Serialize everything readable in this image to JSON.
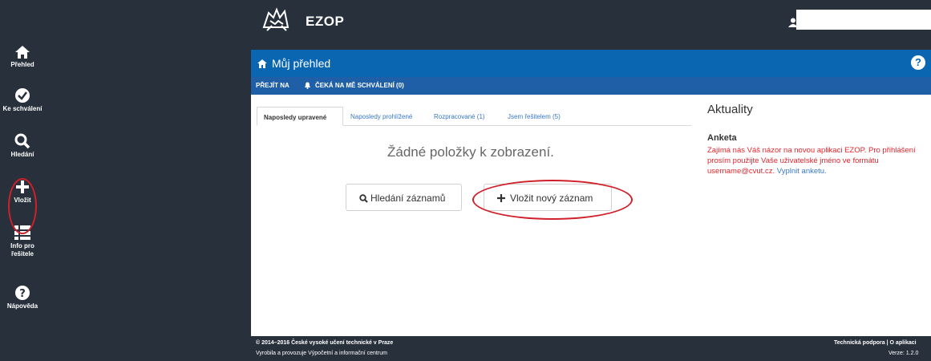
{
  "header": {
    "app_title": "EZOP"
  },
  "sidebar": {
    "items": [
      {
        "label": "Přehled",
        "icon": "home-icon"
      },
      {
        "label": "Ke schválení",
        "icon": "check-circle-icon"
      },
      {
        "label": "Hledání",
        "icon": "search-icon"
      },
      {
        "label": "Vložit",
        "icon": "plus-icon"
      },
      {
        "label": "Info pro",
        "label2": "řešitele",
        "icon": "list-icon"
      },
      {
        "label": "Nápověda",
        "icon": "help-icon"
      }
    ]
  },
  "panel": {
    "title": "Můj přehled",
    "help": "?",
    "go_label": "PŘEJÍT NA",
    "pending_label": "ČEKÁ NA MĚ SCHVÁLENÍ (0)"
  },
  "tabs": [
    {
      "label": "Naposledy upravené"
    },
    {
      "label": "Naposledy prohlížené"
    },
    {
      "label": "Rozpracované (1)"
    },
    {
      "label": "Jsem řešitelem (5)"
    }
  ],
  "main": {
    "empty_message": "Žádné položky k zobrazení.",
    "search_button": "Hledání záznamů",
    "add_button": "Vložit nový záznam"
  },
  "news": {
    "title": "Aktuality",
    "heading": "Anketa",
    "body": "Zajímá nás Váš názor na novou aplikaci EZOP. Pro přihlášení prosím použijte Vaše uživatelské jméno ve formátu username@cvut.cz.",
    "link": "Vyplnit anketu."
  },
  "footer": {
    "copyright": "© 2014–2016 České vysoké učení technické v Praze",
    "developer": "Vyrobila a provozuje Výpočetní a informační centrum",
    "support": "Technická podpora",
    "separator": "|",
    "about": "O aplikaci",
    "version": "Verze: 1.2.0"
  },
  "colors": {
    "sidebar_bg": "#27303b",
    "panel_blue": "#0a66b0",
    "annotation_red": "#d0202a",
    "news_red": "#e0262d"
  }
}
